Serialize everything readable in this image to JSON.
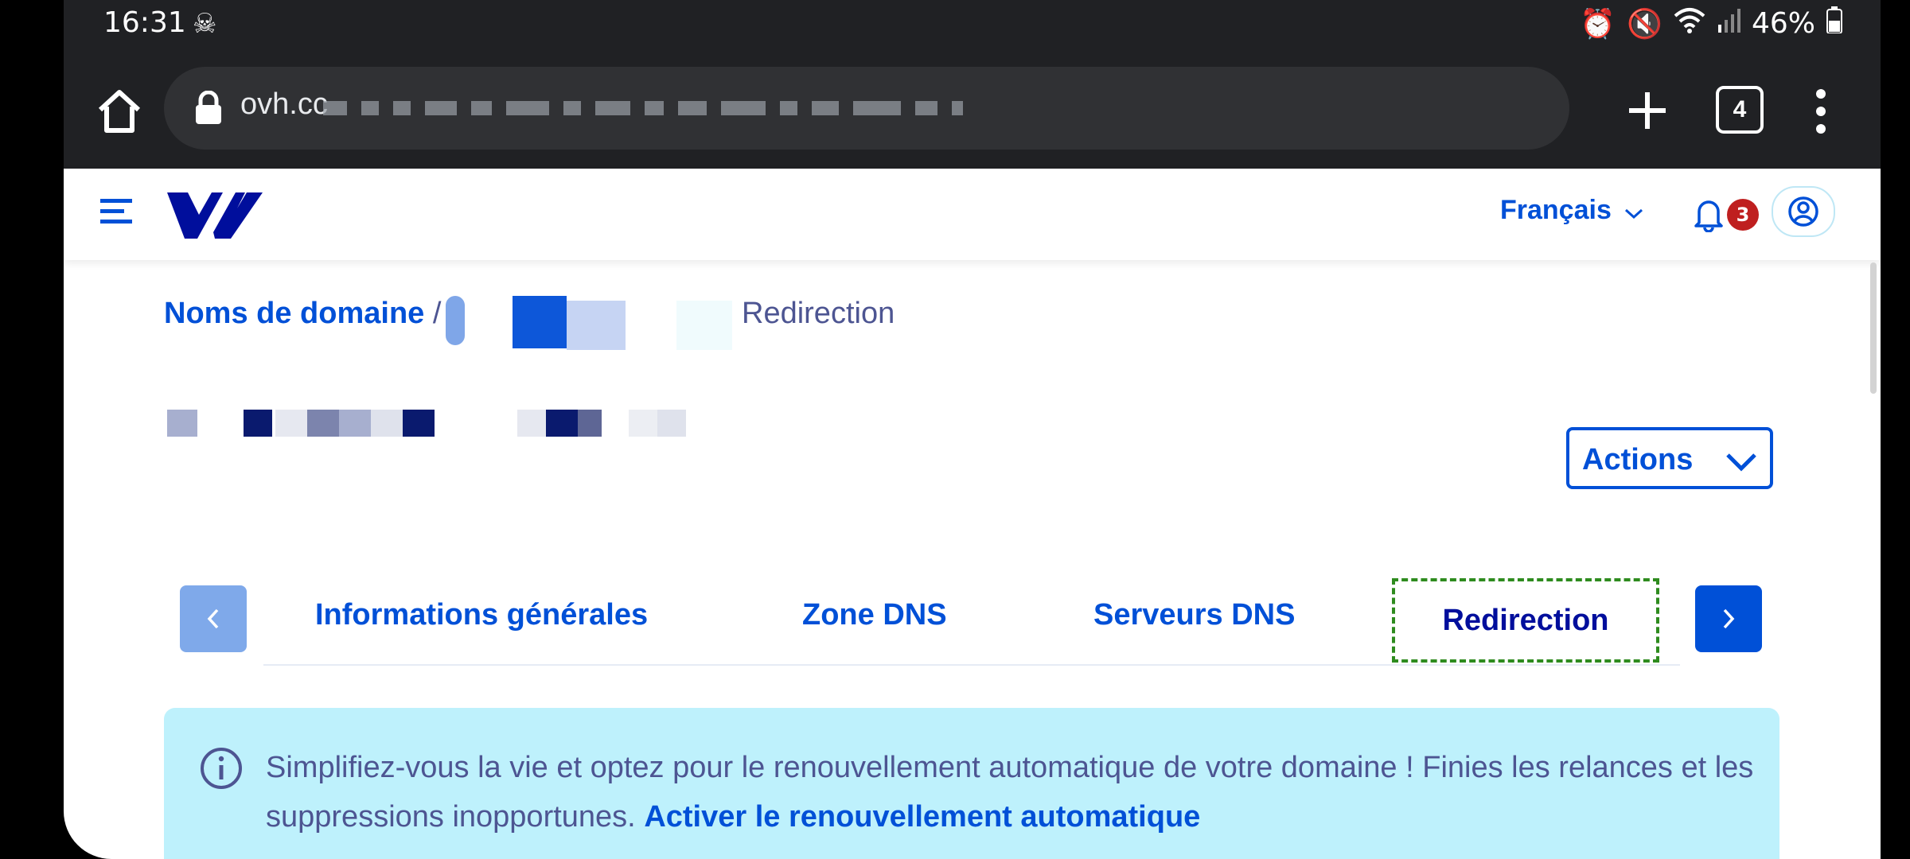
{
  "status_bar": {
    "time": "16:31",
    "battery": "46%",
    "icons": [
      "skull-icon",
      "alarm-icon",
      "mute-icon",
      "wifi-icon",
      "signal-icon",
      "battery-icon"
    ]
  },
  "browser": {
    "url": "ovh.cc",
    "tab_count": "4",
    "icons": [
      "home-icon",
      "lock-icon",
      "plus-icon",
      "tabs-icon",
      "more-vertical-icon"
    ]
  },
  "header": {
    "language": "Français",
    "notification_count": "3",
    "icons": [
      "hamburger-icon",
      "ovh-logo",
      "chevron-down-icon",
      "bell-icon",
      "user-icon"
    ]
  },
  "breadcrumb": {
    "root": "Noms de domaine",
    "separator": "/",
    "current": "Redirection"
  },
  "actions": {
    "label": "Actions"
  },
  "tabs": [
    {
      "label": "Informations générales"
    },
    {
      "label": "Zone DNS"
    },
    {
      "label": "Serveurs DNS"
    },
    {
      "label": "Redirection",
      "active": true
    }
  ],
  "info_banner": {
    "text": "Simplifiez-vous la vie et optez pour le renouvellement automatique de votre domaine ! Finies les relances et les suppressions inopportunes.",
    "link": "Activer le renouvellement automatique"
  },
  "colors": {
    "primary": "#0050d7",
    "banner_bg": "#bef1fc",
    "text": "#4d5592",
    "badge": "#bf1f1f",
    "focus": "#2e8b1e"
  }
}
